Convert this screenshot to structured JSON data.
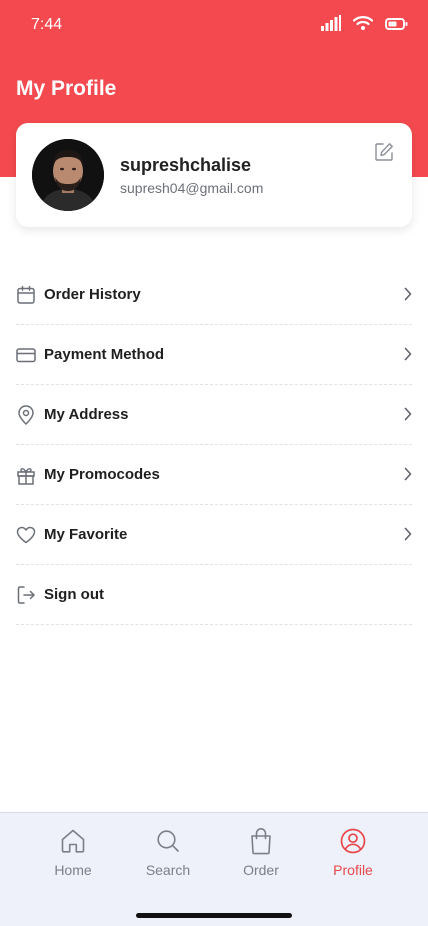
{
  "status_bar": {
    "time": "7:44"
  },
  "header": {
    "title": "My Profile"
  },
  "profile": {
    "name": "supreshchalise",
    "email": "supresh04@gmail.com"
  },
  "menu": {
    "items": [
      {
        "label": "Order History",
        "icon": "calendar-icon"
      },
      {
        "label": "Payment Method",
        "icon": "credit-card-icon"
      },
      {
        "label": "My Address",
        "icon": "location-pin-icon"
      },
      {
        "label": "My Promocodes",
        "icon": "gift-icon"
      },
      {
        "label": "My Favorite",
        "icon": "heart-icon"
      },
      {
        "label": "Sign out",
        "icon": "sign-out-icon"
      }
    ]
  },
  "bottom_nav": {
    "items": [
      {
        "label": "Home",
        "icon": "home-icon",
        "active": false
      },
      {
        "label": "Search",
        "icon": "search-icon",
        "active": false
      },
      {
        "label": "Order",
        "icon": "shopping-bag-icon",
        "active": false
      },
      {
        "label": "Profile",
        "icon": "profile-icon",
        "active": true
      }
    ]
  },
  "colors": {
    "accent": "#f44a4f",
    "nav_background": "#eef1f9",
    "text_muted": "#7b7f88"
  }
}
